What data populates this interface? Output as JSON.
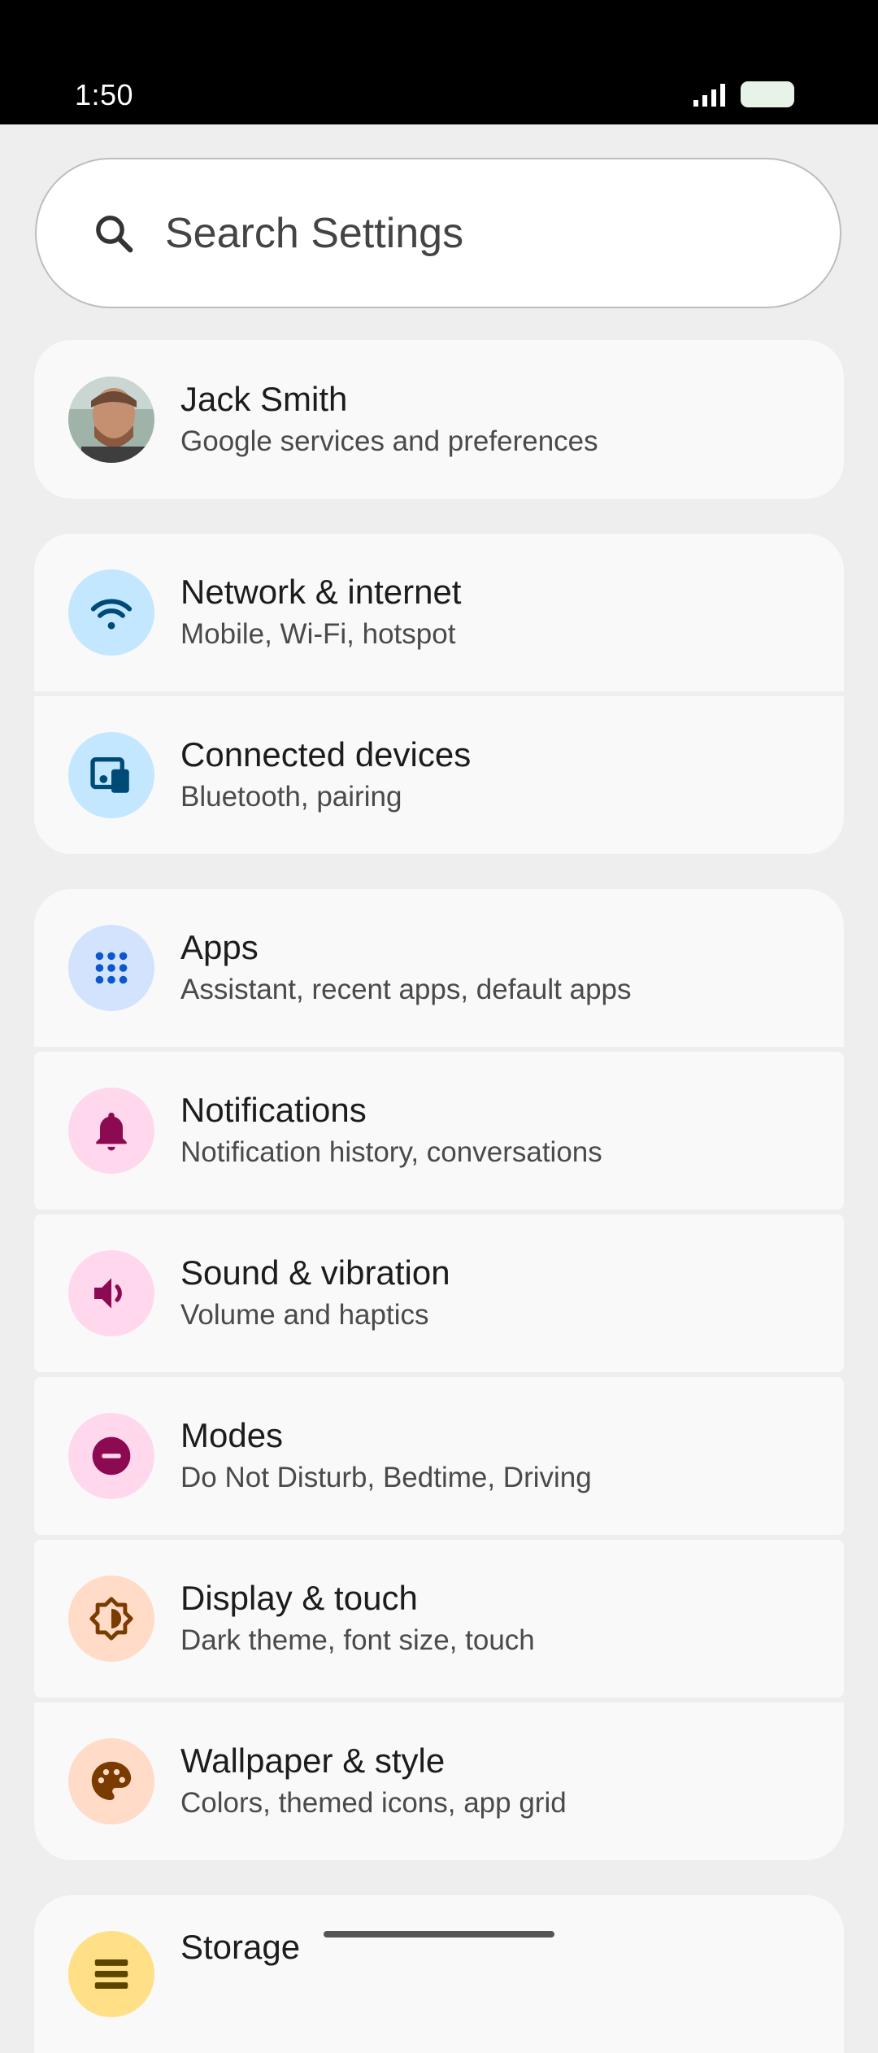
{
  "status_bar": {
    "time": "1:50"
  },
  "search": {
    "placeholder": "Search Settings"
  },
  "account": {
    "name": "Jack Smith",
    "subtitle": "Google services and preferences"
  },
  "items": [
    {
      "title": "Network & internet",
      "subtitle": "Mobile, Wi-Fi, hotspot",
      "icon": "wifi-icon",
      "bg": "#c2e7ff",
      "fg": "#004a77"
    },
    {
      "title": "Connected devices",
      "subtitle": "Bluetooth, pairing",
      "icon": "devices-icon",
      "bg": "#c2e7ff",
      "fg": "#004a77"
    },
    {
      "title": "Apps",
      "subtitle": "Assistant, recent apps, default apps",
      "icon": "apps-grid-icon",
      "bg": "#d3e3fd",
      "fg": "#0b57d0"
    },
    {
      "title": "Notifications",
      "subtitle": "Notification history, conversations",
      "icon": "bell-icon",
      "bg": "#ffd8ee",
      "fg": "#8c0a52"
    },
    {
      "title": "Sound & vibration",
      "subtitle": "Volume and haptics",
      "icon": "speaker-icon",
      "bg": "#ffd8ee",
      "fg": "#8c0a52"
    },
    {
      "title": "Modes",
      "subtitle": "Do Not Disturb, Bedtime, Driving",
      "icon": "do-not-disturb-icon",
      "bg": "#ffd8ee",
      "fg": "#8c0a52"
    },
    {
      "title": "Display & touch",
      "subtitle": "Dark theme, font size, touch",
      "icon": "brightness-icon",
      "bg": "#ffdbc8",
      "fg": "#7a3b00"
    },
    {
      "title": "Wallpaper & style",
      "subtitle": "Colors, themed icons, app grid",
      "icon": "palette-icon",
      "bg": "#ffdbc8",
      "fg": "#7a3b00"
    },
    {
      "title": "Storage",
      "subtitle": "",
      "icon": "storage-icon",
      "bg": "#ffe087",
      "fg": "#5c4500"
    }
  ]
}
